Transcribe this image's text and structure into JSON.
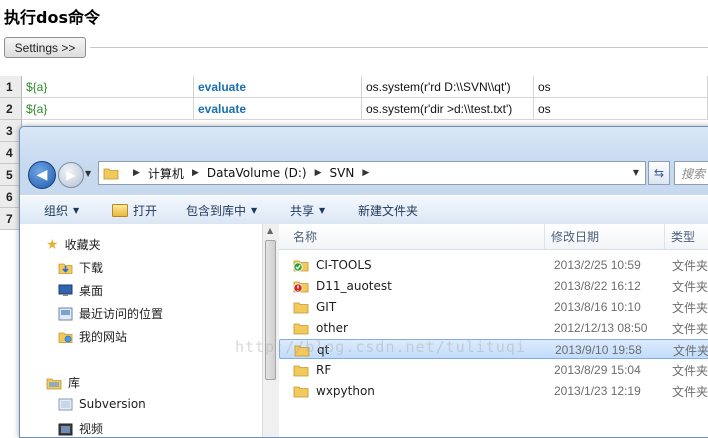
{
  "ride": {
    "title": "执行dos命令",
    "settings_label": "Settings >>",
    "rows": [
      {
        "num": "1",
        "var": "${a}",
        "keyword": "evaluate",
        "arg": "os.system(r'rd D:\\\\SVN\\\\qt')",
        "module": "os"
      },
      {
        "num": "2",
        "var": "${a}",
        "keyword": "evaluate",
        "arg": "os.system(r'dir >d:\\\\test.txt')",
        "module": "os"
      },
      {
        "num": "3"
      },
      {
        "num": "4"
      },
      {
        "num": "5"
      },
      {
        "num": "6"
      },
      {
        "num": "7"
      }
    ]
  },
  "explorer": {
    "breadcrumb": [
      "计算机",
      "DataVolume (D:)",
      "SVN"
    ],
    "search_placeholder": "搜索",
    "toolbar": {
      "organize": "组织",
      "open": "打开",
      "include_in_library": "包含到库中",
      "share": "共享",
      "new_folder": "新建文件夹"
    },
    "nav": {
      "favorites": "收藏夹",
      "downloads": "下载",
      "desktop": "桌面",
      "recent": "最近访问的位置",
      "my_site": "我的网站",
      "libraries": "库",
      "subversion": "Subversion",
      "videos": "视频"
    },
    "columns": {
      "name": "名称",
      "date": "修改日期",
      "type": "类型"
    },
    "files": [
      {
        "name": "CI-TOOLS",
        "date": "2013/2/25 10:59",
        "type": "文件夹",
        "overlay": "green-check"
      },
      {
        "name": "D11_auotest",
        "date": "2013/8/22 16:12",
        "type": "文件夹",
        "overlay": "red-alert"
      },
      {
        "name": "GIT",
        "date": "2013/8/16 10:10",
        "type": "文件夹",
        "overlay": "none"
      },
      {
        "name": "other",
        "date": "2012/12/13 08:50",
        "type": "文件夹",
        "overlay": "none"
      },
      {
        "name": "qt",
        "date": "2013/9/10 19:58",
        "type": "文件夹",
        "overlay": "none",
        "selected": true
      },
      {
        "name": "RF",
        "date": "2013/8/29 15:04",
        "type": "文件夹",
        "overlay": "none"
      },
      {
        "name": "wxpython",
        "date": "2013/1/23 12:19",
        "type": "文件夹",
        "overlay": "none"
      }
    ],
    "watermark": "http://blog.csdn.net/tulituqi"
  },
  "colors": {
    "keyword": "#1a6fb0",
    "variable": "#2e8b2e",
    "selection": "#c1dcfc"
  }
}
